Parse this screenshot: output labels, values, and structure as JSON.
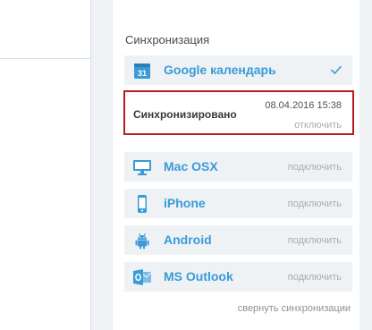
{
  "sync": {
    "title": "Синхронизация",
    "google": {
      "name": "Google календарь",
      "icon": "google-calendar-icon",
      "calendar_day": "31",
      "status": {
        "label": "Синхронизировано",
        "timestamp": "08.04.2016 15:38",
        "disconnect_label": "отключить"
      }
    },
    "services": [
      {
        "name": "Mac OSX",
        "action": "подключить",
        "icon": "monitor-icon"
      },
      {
        "name": "iPhone",
        "action": "подключить",
        "icon": "iphone-icon"
      },
      {
        "name": "Android",
        "action": "подключить",
        "icon": "android-icon"
      },
      {
        "name": "MS Outlook",
        "action": "подключить",
        "icon": "outlook-icon"
      }
    ],
    "collapse_label": "свернуть синхронизации"
  },
  "colors": {
    "accent": "#3a9bd6",
    "row_background": "#eef2f5",
    "highlight_border": "#b81c22"
  }
}
